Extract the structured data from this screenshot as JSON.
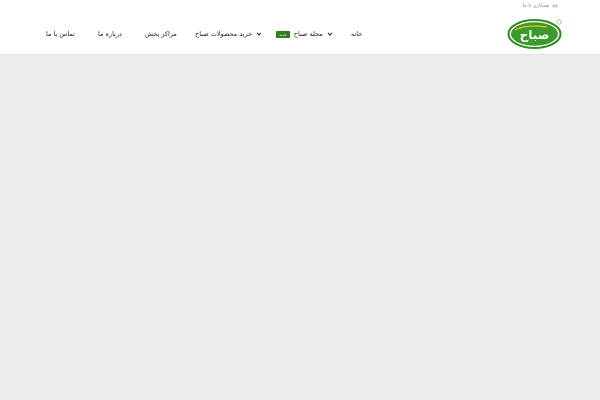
{
  "topbar": {
    "cooperate_label": "همکاری با ما",
    "cooperate_icon": "handshake-icon"
  },
  "logo": {
    "text": "صباح",
    "brand_color": "#3a9a2a",
    "accent_color": "#f2c21b"
  },
  "nav": {
    "home": "خانه",
    "magazine": "مجله صباح",
    "magazine_badge": "جدید",
    "buy_products": "خرید محصولات صباح",
    "distribution_centers": "مراکز پخش",
    "about": "درباره ما",
    "contact": "تماس با ما"
  },
  "colors": {
    "badge_bg": "#2f7d1f",
    "page_bg": "#ececec",
    "header_bg": "#ffffff"
  }
}
